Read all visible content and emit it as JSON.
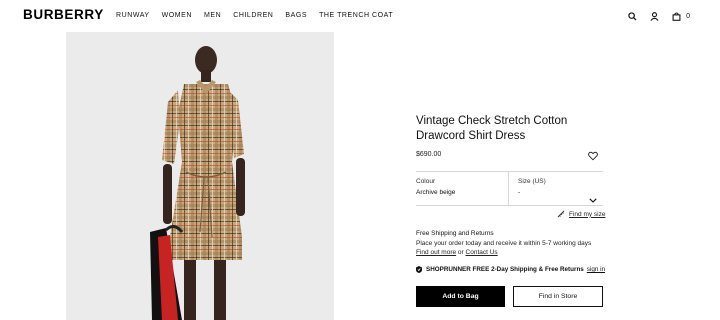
{
  "header": {
    "logo": "BURBERRY",
    "nav": [
      "RUNWAY",
      "WOMEN",
      "MEN",
      "CHILDREN",
      "BAGS",
      "THE TRENCH COAT"
    ],
    "bag_count": "0",
    "icons": [
      "search-icon",
      "account-icon",
      "bag-icon"
    ]
  },
  "product": {
    "title": "Vintage Check Stretch Cotton Drawcord Shirt Dress",
    "price": "$690.00",
    "colour_label": "Colour",
    "colour_value": "Archive beige",
    "size_label": "Size (US)",
    "size_value": "-",
    "size_link": "Find my size",
    "shipping_title": "Free Shipping and Returns",
    "shipping_text": "Place your order today and receive it within 5-7 working days",
    "find_out_more": "Find out more",
    "or_text": "or",
    "contact_us": "Contact Us",
    "shoprunner_text": "SHOPRUNNER FREE 2-Day Shipping & Free Returns",
    "sign_in": "sign in",
    "add_to_bag": "Add to Bag",
    "find_in_store": "Find in Store"
  },
  "colors": {
    "image_bg": "#ebebeb",
    "check_beige": "#c7a77a",
    "button_black": "#000000"
  }
}
